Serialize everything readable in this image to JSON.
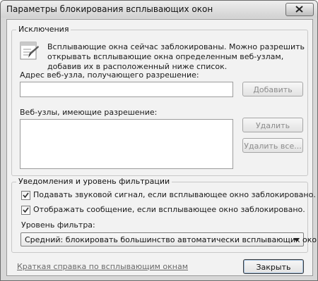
{
  "window": {
    "title": "Параметры блокирования всплывающих окон",
    "close_icon": "close-icon"
  },
  "exceptions": {
    "group_title": "Исключения",
    "info_icon": "popup-blocker-info-icon",
    "info_lines": [
      "Всплывающие окна сейчас заблокированы.  Можно разрешить",
      "открывать всплывающие окна определенным веб-узлам,",
      "добавив их в расположенный ниже список."
    ],
    "address_label": "Адрес веб-узла, получающего разрешение:",
    "address_value": "",
    "add_button": "Добавить",
    "allowed_sites_label": "Веб-узлы, имеющие разрешение:",
    "allowed_sites": [],
    "remove_button": "Удалить",
    "remove_all_button": "Удалить все..."
  },
  "notifications": {
    "group_title": "Уведомления и  уровень фильтрации",
    "play_sound_label": "Подавать звуковой сигнал, если всплывающее окно заблокировано.",
    "play_sound_checked": true,
    "show_info_bar_label": "Отображать сообщение, если всплывающее окно заблокировано.",
    "show_info_bar_checked": true,
    "filter_level_label": "Уровень фильтра:",
    "filter_level_value": "Средний: блокировать большинство автоматически всплывающих окон"
  },
  "footer": {
    "help_link": "Краткая справка по всплывающим окнам",
    "close_button": "Закрыть"
  },
  "colors": {
    "window_frame": "#d7d7d7",
    "client_background": "#f2f2f2",
    "disabled_text": "#8c8c8c"
  }
}
